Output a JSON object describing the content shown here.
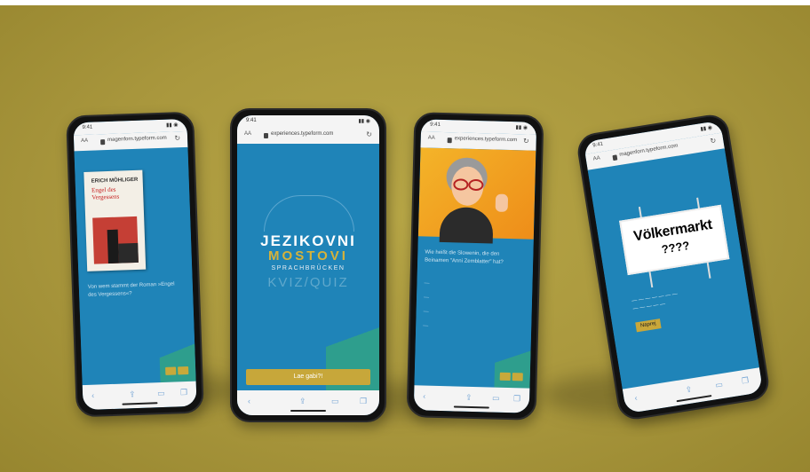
{
  "colors": {
    "backdrop": "#a9973d",
    "app_blue": "#1f84b8",
    "accent_gold": "#c7a73a",
    "logo_gold": "#d6b23a"
  },
  "phone1": {
    "url": "magenforn.typeform.com",
    "book_author": "ERICH MÖHLIGER",
    "book_title": "Engel des Vergessens",
    "question": "Von wem stammt der Roman »Engel des Vergessens«?"
  },
  "phone2": {
    "url": "experiences.typeform.com",
    "logo_line1": "JEZIKOVNI",
    "logo_line2": "MOSTOVI",
    "logo_line3": "SPRACHBRÜCKEN",
    "logo_line4": "KVIZ/QUIZ",
    "start_button": "Lae gabi?!"
  },
  "phone3": {
    "url": "experiences.typeform.com",
    "question": "Wie heißt die Slowenin, die den Beinamen \"Anni Zemblatter\" hat?"
  },
  "phone4": {
    "url": "magenforn.typeform.com",
    "sign_line1": "Völkermarkt",
    "sign_line2": "????",
    "button": "Naprej"
  }
}
